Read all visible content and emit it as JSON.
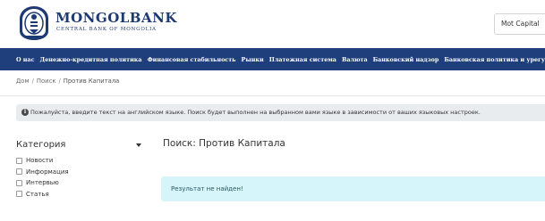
{
  "header": {
    "logo_title": "MONGOLBANK",
    "logo_subtitle": "CENTRAL BANK OF MONGOLIA",
    "language_button": "Mot Capital"
  },
  "nav": {
    "items": [
      "О нас",
      "Денежно-кредитная политика",
      "Финансовая стабильность",
      "Рынки",
      "Платежная система",
      "Валюта",
      "Банковский надзор",
      "Банковская политика и урегулирование"
    ]
  },
  "breadcrumb": {
    "home": "Дом",
    "search": "Поиск",
    "current": "Против Капитала"
  },
  "notice": {
    "text": "Пожалуйста, введите текст на английском языке. Поиск будет выполнен на выбранном вами языке в зависимости от ваших языковых настроек."
  },
  "sidebar": {
    "title": "Категория",
    "categories": [
      "Новости",
      "Информация",
      "Интервью",
      "Статья"
    ]
  },
  "results": {
    "title": "Поиск: Против Капитала",
    "message": "Результат не найден!"
  },
  "colors": {
    "nav_background": "#1e3f7b",
    "brand_blue": "#1e3a73",
    "alert_background": "#d6f5fa",
    "notice_background": "#e9ecef"
  }
}
